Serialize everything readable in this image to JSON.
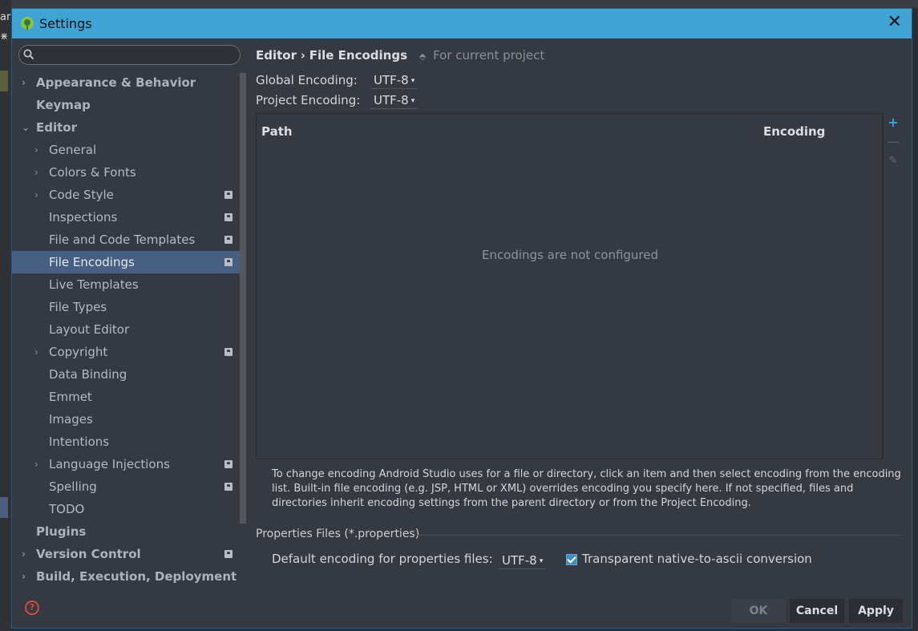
{
  "background": {
    "frag1": "ar",
    "frag2": "⋇"
  },
  "window": {
    "title": "Settings",
    "close_label": "✕"
  },
  "search": {
    "placeholder": "",
    "value": ""
  },
  "tree": {
    "items": [
      {
        "label": "Appearance & Behavior",
        "level": 0,
        "arrow": "›",
        "bold": true,
        "project": false
      },
      {
        "label": "Keymap",
        "level": 0,
        "arrow": "",
        "bold": true,
        "project": false
      },
      {
        "label": "Editor",
        "level": 0,
        "arrow": "⌄",
        "bold": true,
        "project": false
      },
      {
        "label": "General",
        "level": 1,
        "arrow": "›",
        "bold": false,
        "project": false
      },
      {
        "label": "Colors & Fonts",
        "level": 1,
        "arrow": "›",
        "bold": false,
        "project": false
      },
      {
        "label": "Code Style",
        "level": 1,
        "arrow": "›",
        "bold": false,
        "project": true
      },
      {
        "label": "Inspections",
        "level": 1,
        "arrow": "",
        "bold": false,
        "project": true
      },
      {
        "label": "File and Code Templates",
        "level": 1,
        "arrow": "",
        "bold": false,
        "project": true
      },
      {
        "label": "File Encodings",
        "level": 1,
        "arrow": "",
        "bold": false,
        "project": true,
        "selected": true
      },
      {
        "label": "Live Templates",
        "level": 1,
        "arrow": "",
        "bold": false,
        "project": false
      },
      {
        "label": "File Types",
        "level": 1,
        "arrow": "",
        "bold": false,
        "project": false
      },
      {
        "label": "Layout Editor",
        "level": 1,
        "arrow": "",
        "bold": false,
        "project": false
      },
      {
        "label": "Copyright",
        "level": 1,
        "arrow": "›",
        "bold": false,
        "project": true
      },
      {
        "label": "Data Binding",
        "level": 1,
        "arrow": "",
        "bold": false,
        "project": false
      },
      {
        "label": "Emmet",
        "level": 1,
        "arrow": "",
        "bold": false,
        "project": false
      },
      {
        "label": "Images",
        "level": 1,
        "arrow": "",
        "bold": false,
        "project": false
      },
      {
        "label": "Intentions",
        "level": 1,
        "arrow": "",
        "bold": false,
        "project": false
      },
      {
        "label": "Language Injections",
        "level": 1,
        "arrow": "›",
        "bold": false,
        "project": true
      },
      {
        "label": "Spelling",
        "level": 1,
        "arrow": "",
        "bold": false,
        "project": true
      },
      {
        "label": "TODO",
        "level": 1,
        "arrow": "",
        "bold": false,
        "project": false
      },
      {
        "label": "Plugins",
        "level": 0,
        "arrow": "",
        "bold": true,
        "project": false
      },
      {
        "label": "Version Control",
        "level": 0,
        "arrow": "›",
        "bold": true,
        "project": true
      },
      {
        "label": "Build, Execution, Deployment",
        "level": 0,
        "arrow": "›",
        "bold": true,
        "project": false
      }
    ]
  },
  "help": {
    "label": "?"
  },
  "content": {
    "breadcrumb": {
      "parent": "Editor",
      "separator": "›",
      "current": "File Encodings",
      "scope_icon": "⬘",
      "scope": "For current project"
    },
    "global_encoding": {
      "label": "Global Encoding:",
      "value": "UTF-8",
      "caret": "▾"
    },
    "project_encoding": {
      "label": "Project Encoding:",
      "value": "UTF-8",
      "caret": "▾"
    },
    "table": {
      "columns": {
        "path": "Path",
        "encoding": "Encoding"
      },
      "empty_text": "Encodings are not configured"
    },
    "tools": {
      "add": "+",
      "remove": "—",
      "edit": "✎"
    },
    "info_text": "To change encoding Android Studio uses for a file or directory, click an item and then select encoding from the encoding list. Built-in file encoding (e.g. JSP, HTML or XML) overrides encoding you specify here. If not specified, files and directories inherit encoding settings from the parent directory or from the Project Encoding.",
    "properties": {
      "section_title": "Properties Files (*.properties)",
      "default_label": "Default encoding for properties files:",
      "default_value": "UTF-8",
      "caret": "▾",
      "transparent_label": "Transparent native-to-ascii conversion",
      "transparent_checked": true
    }
  },
  "buttons": {
    "ok": "OK",
    "cancel": "Cancel",
    "apply": "Apply"
  },
  "colors": {
    "titlebar": "#3fa3d3",
    "selection": "#475f82",
    "accent": "#3fa3d3",
    "help": "#d9483e"
  }
}
